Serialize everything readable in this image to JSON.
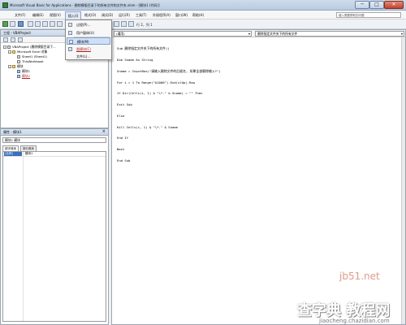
{
  "window": {
    "title": "Microsoft Visual Basic for Applications - 删除模版目录下的所有文件和文件夹.xlsm - [模块1 (代码)]",
    "controls": {
      "minimize": "─",
      "maximize": "□",
      "close": "✕"
    }
  },
  "menubar": {
    "items": [
      "文件(F)",
      "编辑(E)",
      "视图(V)",
      "插入(I)",
      "格式(O)",
      "调试(D)",
      "运行(R)",
      "工具(T)",
      "外接程序(A)",
      "窗口(W)",
      "帮助(H)"
    ],
    "help_box": "键入需要帮助的问题"
  },
  "toolbar": {
    "status": "行 2，列 1"
  },
  "insert_menu": {
    "items": [
      {
        "label": "过程(P)...",
        "icon": "procedure-icon"
      },
      {
        "label": "用户窗体(U)",
        "icon": "userform-icon"
      },
      {
        "label": "模块(M)",
        "icon": "module-icon",
        "highlighted": true
      },
      {
        "label": "类模块(C)",
        "icon": "class-module-icon"
      },
      {
        "label": "文件(L)...",
        "icon": "file-icon"
      }
    ]
  },
  "project_pane": {
    "title": "工程 - VBAProject",
    "close": "×",
    "tree": [
      {
        "label": "VBAProject (删除模版目录下...",
        "level": 0,
        "type": "project"
      },
      {
        "label": "Microsoft Excel 对象",
        "level": 1,
        "type": "folder"
      },
      {
        "label": "Sheet1 (Sheet1)",
        "level": 2,
        "type": "sheet"
      },
      {
        "label": "ThisWorkbook",
        "level": 2,
        "type": "sheet"
      },
      {
        "label": "模块",
        "level": 1,
        "type": "folder"
      },
      {
        "label": "模块1",
        "level": 2,
        "type": "module"
      },
      {
        "label": "模块2",
        "level": 2,
        "type": "module"
      }
    ]
  },
  "props_pane": {
    "title": "属性 - 模块1",
    "close": "×",
    "object": "模块1  模块",
    "tabs": [
      "按字母序",
      "按分类序"
    ],
    "rows": [
      {
        "key": "(名称)",
        "value": "模块1"
      }
    ]
  },
  "code_window": {
    "proc_combo": "(通用)",
    "member_combo": "删除指定文件夹下的所有文件",
    "lines": [
      "Sub 删除指定文件夹下的所有文件()",
      "Dim Sname As String",
      "Sname = InputBox(\"请输入删除文件的后缀名, 如果全部删除输入*\")",
      "For i = 1 To Range(\"A1000\").End(xlUp).Row",
      "If Dir(Cells(i, 1) & \"\\*.\" & Sname) = \"\" Then",
      "Exit Sub",
      "Else",
      "Kill Cells(i, 1) & \"\\*.\" & Sname",
      "End If",
      "Next",
      "End Sub"
    ]
  },
  "watermark": {
    "line1": "jb51.net",
    "line2": "查字典 教程网",
    "line3": "jiaocheng.chazidian.com"
  }
}
